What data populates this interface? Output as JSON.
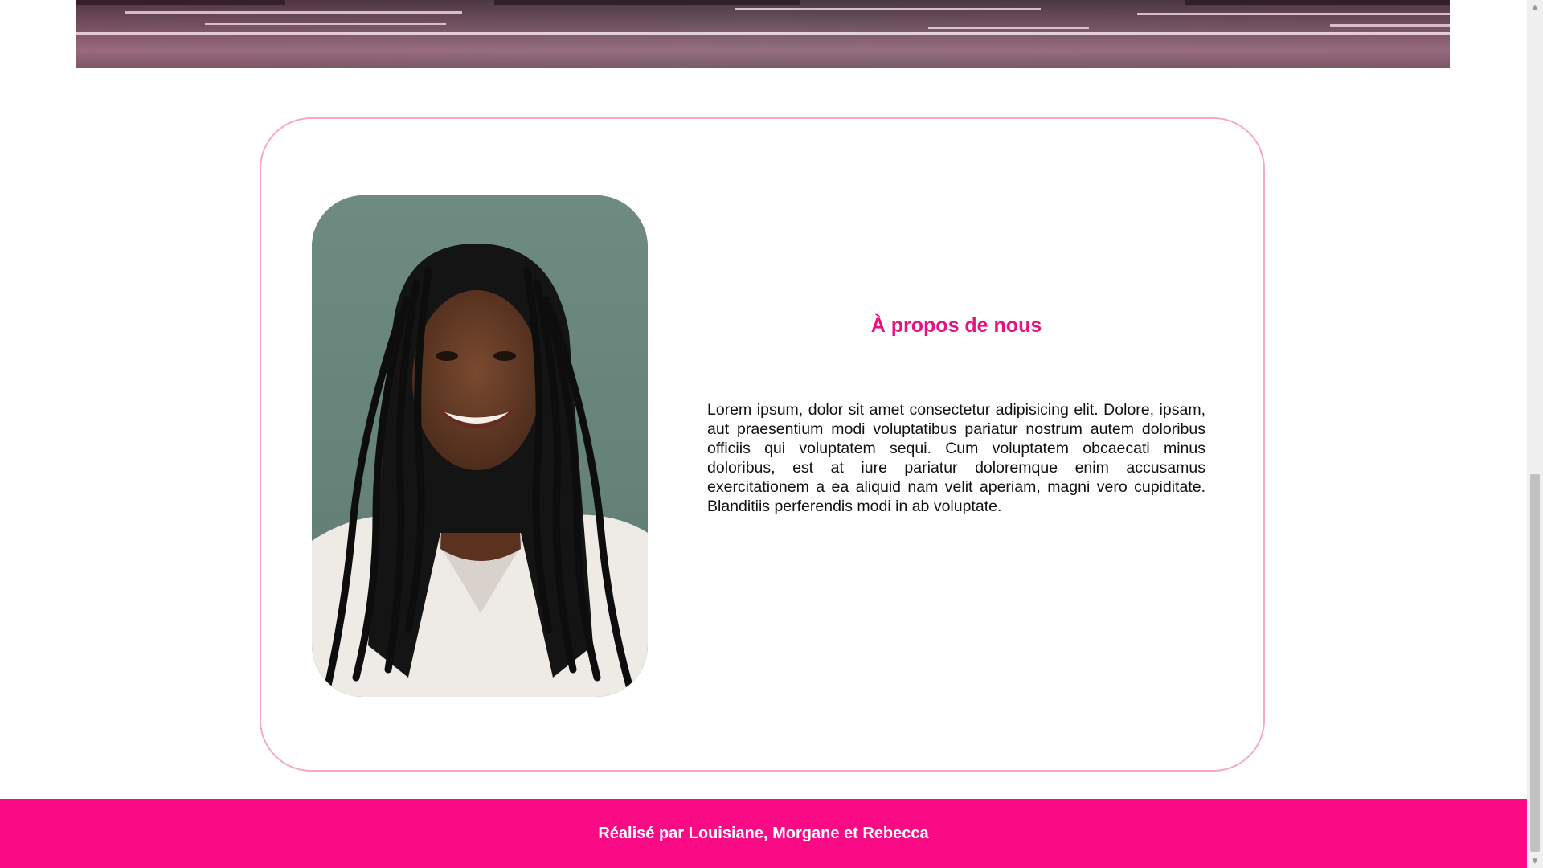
{
  "about": {
    "title": "À propos de nous",
    "body": "Lorem ipsum, dolor sit amet consectetur adipisicing elit. Dolore, ipsam, aut praesentium modi voluptatibus pariatur nostrum autem doloribus officiis qui voluptatem sequi. Cum voluptatem obcaecati minus doloribus, est at iure pariatur doloremque enim accusamus exercitationem a ea aliquid nam velit aperiam, magni vero cupiditate. Blanditiis perferendis modi in ab voluptate."
  },
  "footer": {
    "credit": "Réalisé par Louisiane, Morgane et Rebecca"
  },
  "scrollbar": {
    "up_icon": "▲",
    "down_icon": "▼"
  },
  "colors": {
    "accent": "#e6127f",
    "footer_bg": "#fb0a85",
    "card_border": "#f7a8c8"
  },
  "icons": {
    "scroll_up": "triangle-up-icon",
    "scroll_down": "triangle-down-icon"
  }
}
